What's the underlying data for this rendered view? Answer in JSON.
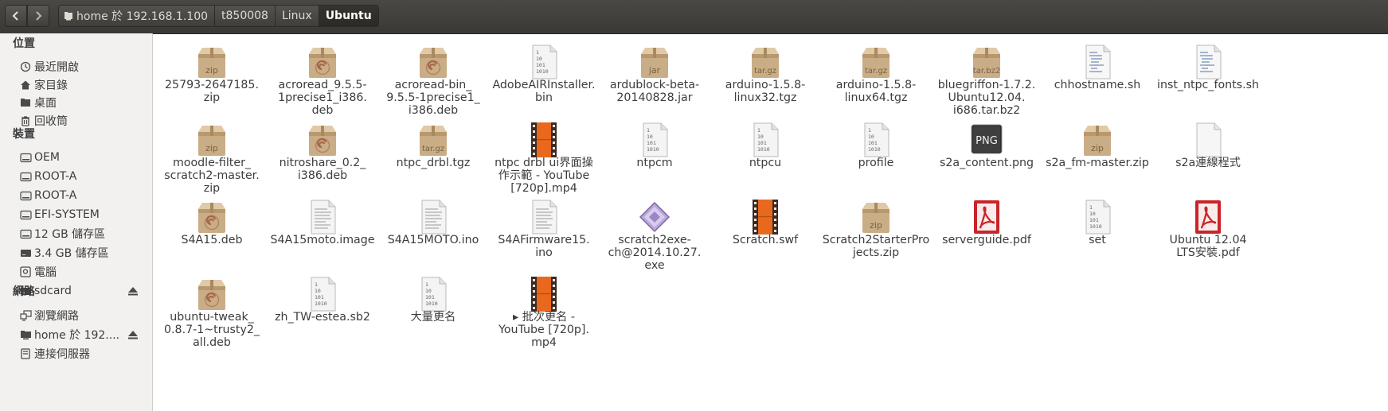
{
  "toolbar": {
    "back_label": "<",
    "forward_label": ">",
    "breadcrumbs": [
      {
        "label": "home 於 192.168.1.100"
      },
      {
        "label": "t850008"
      },
      {
        "label": "Linux"
      },
      {
        "label": "Ubuntu"
      }
    ]
  },
  "sidebar": {
    "places_header": "位置",
    "places": [
      {
        "label": "最近開啟",
        "icon": "recent-icon"
      },
      {
        "label": "家目錄",
        "icon": "home-icon"
      },
      {
        "label": "桌面",
        "icon": "desktop-folder-icon"
      },
      {
        "label": "回收筒",
        "icon": "trash-icon"
      }
    ],
    "devices_header": "裝置",
    "devices": [
      {
        "label": "OEM",
        "icon": "drive-icon"
      },
      {
        "label": "ROOT-A",
        "icon": "drive-icon"
      },
      {
        "label": "ROOT-A",
        "icon": "drive-icon"
      },
      {
        "label": "EFI-SYSTEM",
        "icon": "drive-icon"
      },
      {
        "label": "12 GB 儲存區",
        "icon": "drive-icon"
      },
      {
        "label": "3.4 GB 儲存區",
        "icon": "removable-drive-icon"
      },
      {
        "label": "電腦",
        "icon": "computer-icon"
      },
      {
        "label": "sdcard",
        "icon": "removable-drive-icon",
        "eject": true
      }
    ],
    "network_header": "網路",
    "network": [
      {
        "label": "瀏覽網路",
        "icon": "network-icon"
      },
      {
        "label": "home 於 192....",
        "icon": "network-folder-icon",
        "eject": true
      },
      {
        "label": "連接伺服器",
        "icon": "server-icon"
      }
    ]
  },
  "files": [
    {
      "name": "25793-2647185.\nzip",
      "type": "archive",
      "badge": "zip"
    },
    {
      "name": "acroread_9.5.5-\n1precise1_i386.\ndeb",
      "type": "deb"
    },
    {
      "name": "acroread-bin_\n9.5.5-1precise1_\ni386.deb",
      "type": "deb"
    },
    {
      "name": "AdobeAIRInstaller.\nbin",
      "type": "binary"
    },
    {
      "name": "ardublock-beta-\n20140828.jar",
      "type": "archive",
      "badge": "jar"
    },
    {
      "name": "arduino-1.5.8-\nlinux32.tgz",
      "type": "archive",
      "badge": "tar.gz"
    },
    {
      "name": "arduino-1.5.8-\nlinux64.tgz",
      "type": "archive",
      "badge": "tar.gz"
    },
    {
      "name": "bluegriffon-1.7.2.\nUbuntu12.04.\ni686.tar.bz2",
      "type": "archive",
      "badge": "tar.bz2"
    },
    {
      "name": "chhostname.sh",
      "type": "script"
    },
    {
      "name": "inst_ntpc_fonts.sh",
      "type": "script"
    },
    {
      "name": "moodle-filter_\nscratch2-master.\nzip",
      "type": "archive",
      "badge": "zip"
    },
    {
      "name": "nitroshare_0.2_\ni386.deb",
      "type": "deb"
    },
    {
      "name": "ntpc_drbl.tgz",
      "type": "archive",
      "badge": "tar.gz"
    },
    {
      "name": "ntpc drbl ui界面操\n作示範 - YouTube\n[720p].mp4",
      "type": "video"
    },
    {
      "name": "ntpcm",
      "type": "binary"
    },
    {
      "name": "ntpcu",
      "type": "binary"
    },
    {
      "name": "profile",
      "type": "binary"
    },
    {
      "name": "s2a_content.png",
      "type": "image",
      "badge": "PNG"
    },
    {
      "name": "s2a_fm-master.zip",
      "type": "archive",
      "badge": "zip"
    },
    {
      "name": "s2a連線程式",
      "type": "blank"
    },
    {
      "name": "S4A15.deb",
      "type": "deb"
    },
    {
      "name": "S4A15moto.image",
      "type": "text"
    },
    {
      "name": "S4A15MOTO.ino",
      "type": "text"
    },
    {
      "name": "S4AFirmware15.\nino",
      "type": "text"
    },
    {
      "name": "scratch2exe-\nch@2014.10.27.\nexe",
      "type": "exe"
    },
    {
      "name": "Scratch.swf",
      "type": "video"
    },
    {
      "name": "Scratch2StarterPro\njects.zip",
      "type": "archive",
      "badge": "zip"
    },
    {
      "name": "serverguide.pdf",
      "type": "pdf"
    },
    {
      "name": "set",
      "type": "binary"
    },
    {
      "name": "Ubuntu 12.04\nLTS安裝.pdf",
      "type": "pdf"
    },
    {
      "name": "ubuntu-tweak_\n0.8.7-1~trusty2_\nall.deb",
      "type": "deb"
    },
    {
      "name": "zh_TW-estea.sb2",
      "type": "binary"
    },
    {
      "name": "大量更名",
      "type": "binary"
    },
    {
      "name": "▸ 批次更名 -\nYouTube [720p].\nmp4",
      "type": "video"
    }
  ],
  "colors": {
    "toolbar": "#3c3b37",
    "sidebar": "#f2f1f0",
    "archive_box": "#c9ad86",
    "deb_swirl": "#a8664a",
    "pdf_red": "#c8252a",
    "video_orange": "#e8691d",
    "text": "#3c3c3c"
  }
}
